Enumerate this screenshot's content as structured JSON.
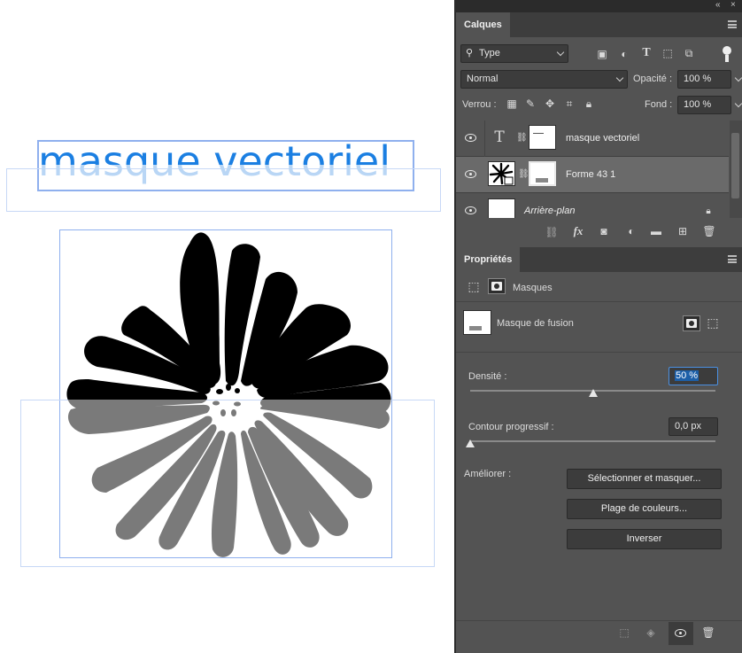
{
  "canvas": {
    "text_layer_content": "masque vectoriel"
  },
  "layers_panel": {
    "tab": "Calques",
    "filter": {
      "value": "Type"
    },
    "blend_mode": "Normal",
    "opacity": {
      "label": "Opacité :",
      "value": "100 %"
    },
    "lock": {
      "label": "Verrou :"
    },
    "fill": {
      "label": "Fond :",
      "value": "100 %"
    },
    "layers": [
      {
        "name": "masque vectoriel",
        "kind": "text",
        "visible": true
      },
      {
        "name": "Forme 43 1",
        "kind": "shape",
        "visible": true,
        "selected": true
      },
      {
        "name": "Arrière-plan",
        "kind": "background",
        "visible": true,
        "locked": true
      }
    ],
    "footer_icons": [
      "link-icon",
      "fx-icon",
      "add-mask-icon",
      "adjustment-icon",
      "folder-icon",
      "new-layer-icon",
      "trash-icon"
    ],
    "fx_label": "fx"
  },
  "properties_panel": {
    "tab": "Propriétés",
    "section_label": "Masques",
    "mask_type": "Masque de fusion",
    "density": {
      "label": "Densité :",
      "value": "50 %",
      "level_percent": 50
    },
    "feather": {
      "label": "Contour progressif :",
      "value": "0,0 px",
      "level_percent": 0
    },
    "refine_label": "Améliorer :",
    "buttons": {
      "select_and_mask": "Sélectionner et masquer...",
      "color_range": "Plage de couleurs...",
      "invert": "Inverser"
    }
  },
  "top_bar": {
    "collapse_icon": "«",
    "close_icon": "×"
  },
  "colors": {
    "panel_bg": "#535353",
    "selected_layer": "#6a6a6a",
    "canvas_text": "#1b7fe2",
    "selection_guide": "#8fb0ee",
    "field_highlight": "#1c5fa8"
  }
}
